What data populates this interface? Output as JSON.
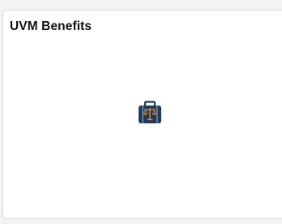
{
  "tile": {
    "title": "UVM Benefits",
    "icon": "briefcase-scales-icon"
  },
  "colors": {
    "briefcase": "#1f3a56",
    "accent": "#e8812d",
    "tile_background": "#ffffff",
    "tile_border": "#d6d6d6",
    "page_background": "#f3f3f3"
  }
}
